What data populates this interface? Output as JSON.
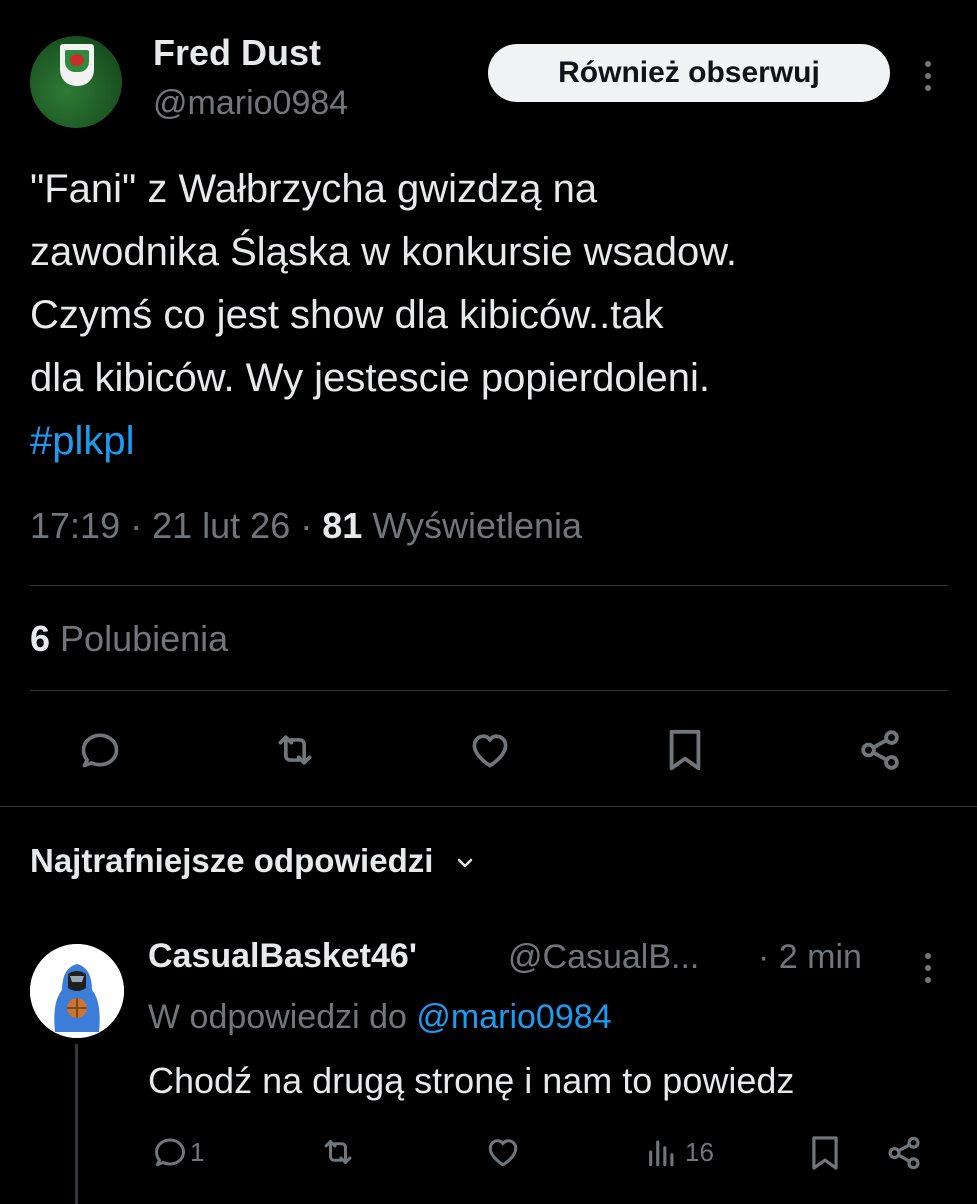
{
  "tweet": {
    "author": {
      "name": "Fred Dust",
      "handle": "@mario0984"
    },
    "follow_button": "Również obserwuj",
    "text_lines": [
      "\"Fani\" z Wałbrzycha gwizdzą na",
      "zawodnika Śląska w konkursie wsadow.",
      "Czymś co jest show dla kibiców..tak",
      "dla kibiców.  Wy jestescie popierdoleni."
    ],
    "hashtag": "#plkpl",
    "time": "17:19",
    "date": "21 lut 26",
    "views_count": "81",
    "views_label": "Wyświetlenia",
    "likes_count": "6",
    "likes_label": "Polubienia",
    "actions": [
      "reply-icon",
      "retweet-icon",
      "like-icon",
      "bookmark-icon",
      "share-icon"
    ]
  },
  "replies_section": {
    "title": "Najtrafniejsze odpowiedzi"
  },
  "reply": {
    "name": "CasualBasket46'",
    "handle": "@CasualB...",
    "time": "2 min",
    "reply_to_label": "W odpowiedzi do",
    "reply_to_handle": "@mario0984",
    "text": "Chodź na drugą stronę i nam to powiedz",
    "reply_count": "1",
    "views_count": "16"
  },
  "colors": {
    "background": "#000000",
    "text": "#e7e9ea",
    "muted": "#71767b",
    "accent": "#1d9bf0",
    "divider": "#2f3336"
  }
}
